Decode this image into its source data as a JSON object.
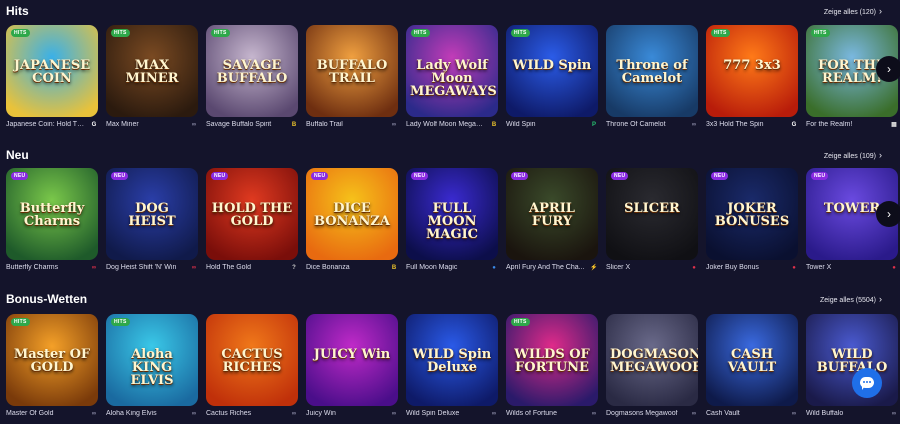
{
  "sections": [
    {
      "title": "Hits",
      "show_all": "Zeige alles (120)",
      "games": [
        {
          "name": "Japanese Coin: Hold The...",
          "logo": "JAPANESE COIN",
          "badge": "HITS",
          "bg": [
            "#3ab0e8",
            "#e9c23a"
          ],
          "prov_color": "#ffffff",
          "prov_glyph": "G"
        },
        {
          "name": "Max Miner",
          "logo": "MAX MINER",
          "badge": "HITS",
          "bg": [
            "#7a4a22",
            "#2b1a0e"
          ],
          "prov_color": "#8d8da8",
          "prov_glyph": "∞"
        },
        {
          "name": "Savage Buffalo Spirit",
          "logo": "SAVAGE BUFFALO",
          "badge": "HITS",
          "bg": [
            "#c6b6ce",
            "#5a4870"
          ],
          "prov_color": "#e8c02a",
          "prov_glyph": "B"
        },
        {
          "name": "Buffalo Trail",
          "logo": "BUFFALO TRAIL",
          "badge": "",
          "bg": [
            "#f0a040",
            "#6e2e10"
          ],
          "prov_color": "#8d8da8",
          "prov_glyph": "∞"
        },
        {
          "name": "Lady Wolf Moon Megaw...",
          "logo": "Lady Wolf Moon MEGAWAYS",
          "badge": "HITS",
          "bg": [
            "#c23cb8",
            "#2b2a8a"
          ],
          "prov_color": "#e8c02a",
          "prov_glyph": "B"
        },
        {
          "name": "Wild Spin",
          "logo": "WILD Spin",
          "badge": "HITS",
          "bg": [
            "#2b5ce8",
            "#0e1a68"
          ],
          "prov_color": "#27c070",
          "prov_glyph": "P"
        },
        {
          "name": "Throne Of Camelot",
          "logo": "Throne of Camelot",
          "badge": "",
          "bg": [
            "#3a8ad8",
            "#173a66"
          ],
          "prov_color": "#8d8da8",
          "prov_glyph": "∞"
        },
        {
          "name": "3x3 Hold The Spin",
          "logo": "777 3x3",
          "badge": "HITS",
          "bg": [
            "#ff7a18",
            "#b81c0a"
          ],
          "prov_color": "#ffffff",
          "prov_glyph": "G"
        },
        {
          "name": "For the Realm!",
          "logo": "FOR THE REALM!",
          "badge": "HITS",
          "bg": [
            "#7ab8e0",
            "#3a6e2a"
          ],
          "prov_color": "#dddddd",
          "prov_glyph": "▦"
        }
      ]
    },
    {
      "title": "Neu",
      "show_all": "Zeige alles (109)",
      "games": [
        {
          "name": "Butterfly Charms",
          "logo": "Butterfly Charms",
          "badge": "NEU",
          "bg": [
            "#7ac84a",
            "#1e5a2a"
          ],
          "prov_color": "#e0304a",
          "prov_glyph": "∞"
        },
        {
          "name": "Dog Heist Shift 'N' Win",
          "logo": "DOG HEIST",
          "badge": "NEU",
          "bg": [
            "#2a3ea8",
            "#101a4a"
          ],
          "prov_color": "#e0304a",
          "prov_glyph": "∞"
        },
        {
          "name": "Hold The Gold",
          "logo": "HOLD THE GOLD",
          "badge": "NEU",
          "bg": [
            "#e03a20",
            "#7a0e0a"
          ],
          "prov_color": "#cccccc",
          "prov_glyph": "?"
        },
        {
          "name": "Dice Bonanza",
          "logo": "DICE BONANZA",
          "badge": "NEU",
          "bg": [
            "#f6c21a",
            "#e86a10"
          ],
          "prov_color": "#e8c02a",
          "prov_glyph": "B"
        },
        {
          "name": "Full Moon Magic",
          "logo": "FULL MOON MAGIC",
          "badge": "NEU",
          "bg": [
            "#3a2ad0",
            "#0c0e4a"
          ],
          "prov_color": "#3a8ae8",
          "prov_glyph": "●"
        },
        {
          "name": "April Fury And The Cha...",
          "logo": "APRIL FURY",
          "badge": "NEU",
          "bg": [
            "#3a4a2a",
            "#1a140e"
          ],
          "prov_color": "#e8c02a",
          "prov_glyph": "⚡"
        },
        {
          "name": "Slicer X",
          "logo": "SLICER",
          "badge": "NEU",
          "bg": [
            "#2a2a30",
            "#101014"
          ],
          "prov_color": "#e0304a",
          "prov_glyph": "●"
        },
        {
          "name": "Joker Buy Bonus",
          "logo": "JOKER BONUSES",
          "badge": "NEU",
          "bg": [
            "#1a2a6a",
            "#0a1030"
          ],
          "prov_color": "#e0304a",
          "prov_glyph": "●"
        },
        {
          "name": "Tower X",
          "logo": "TOWER",
          "badge": "NEU",
          "bg": [
            "#6a4ae0",
            "#2a1a8a"
          ],
          "prov_color": "#e0304a",
          "prov_glyph": "●"
        }
      ]
    },
    {
      "title": "Bonus-Wetten",
      "show_all": "Zeige alles (5504)",
      "games": [
        {
          "name": "Master Of Gold",
          "logo": "Master OF GOLD",
          "badge": "HITS",
          "bg": [
            "#f4a028",
            "#7a3a0a"
          ],
          "prov_color": "#8d8da8",
          "prov_glyph": "∞"
        },
        {
          "name": "Aloha King Elvis",
          "logo": "Aloha KING ELVIS",
          "badge": "HITS",
          "bg": [
            "#3ac8e8",
            "#1a6aa0"
          ],
          "prov_color": "#8d8da8",
          "prov_glyph": "∞"
        },
        {
          "name": "Cactus Riches",
          "logo": "CACTUS RICHES",
          "badge": "",
          "bg": [
            "#f0781a",
            "#c0300a"
          ],
          "prov_color": "#8d8da8",
          "prov_glyph": "∞"
        },
        {
          "name": "Juicy Win",
          "logo": "JUICY Win",
          "badge": "",
          "bg": [
            "#c02ac8",
            "#4a0e8a"
          ],
          "prov_color": "#8d8da8",
          "prov_glyph": "∞"
        },
        {
          "name": "Wild Spin Deluxe",
          "logo": "WILD Spin Deluxe",
          "badge": "",
          "bg": [
            "#2a5ae8",
            "#0e1a68"
          ],
          "prov_color": "#8d8da8",
          "prov_glyph": "∞"
        },
        {
          "name": "Wilds of Fortune",
          "logo": "WILDS OF FORTUNE",
          "badge": "HITS",
          "bg": [
            "#e02a8a",
            "#2a1a6a"
          ],
          "prov_color": "#8d8da8",
          "prov_glyph": "∞"
        },
        {
          "name": "Dogmasons Megawoof",
          "logo": "DOGMASONS MEGAWOOF",
          "badge": "",
          "bg": [
            "#6a6a8a",
            "#2a2a44"
          ],
          "prov_color": "#8d8da8",
          "prov_glyph": "∞"
        },
        {
          "name": "Cash Vault",
          "logo": "CASH VAULT",
          "badge": "",
          "bg": [
            "#3a6ae0",
            "#0e1a4a"
          ],
          "prov_color": "#8d8da8",
          "prov_glyph": "∞"
        },
        {
          "name": "Wild Buffalo",
          "logo": "WILD BUFFALO",
          "badge": "",
          "bg": [
            "#4a5ad0",
            "#1a1a4a"
          ],
          "prov_color": "#8d8da8",
          "prov_glyph": "∞"
        }
      ]
    }
  ],
  "icons": {
    "next_arrow": "›",
    "chevron": "›"
  }
}
